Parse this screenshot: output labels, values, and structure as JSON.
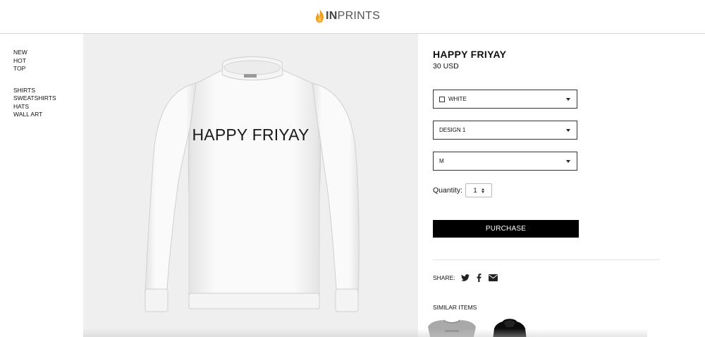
{
  "brand": {
    "name_prefix": "IN",
    "name_suffix": "PRINTS"
  },
  "sidebar": {
    "group1": [
      {
        "label": "NEW"
      },
      {
        "label": "HOT"
      },
      {
        "label": "TOP"
      }
    ],
    "group2": [
      {
        "label": "SHIRTS"
      },
      {
        "label": "SWEATSHIRTS"
      },
      {
        "label": "HATS"
      },
      {
        "label": "WALL ART"
      }
    ]
  },
  "product": {
    "print_text": "HAPPY FRIYAY",
    "title": "HAPPY FRIYAY",
    "price": "30 USD",
    "color_select": "WHITE",
    "design_select": "DESIGN 1",
    "size_select": "M",
    "quantity_label": "Quantity:",
    "quantity_value": "1",
    "purchase_label": "PURCHASE"
  },
  "share": {
    "label": "SHARE:",
    "icons": [
      "twitter-icon",
      "facebook-icon",
      "email-icon"
    ]
  },
  "similar": {
    "title": "SIMILAR ITEMS"
  },
  "colors": {
    "accent_flame": "#f0a020",
    "button_bg": "#000000",
    "image_bg": "#efefef"
  }
}
